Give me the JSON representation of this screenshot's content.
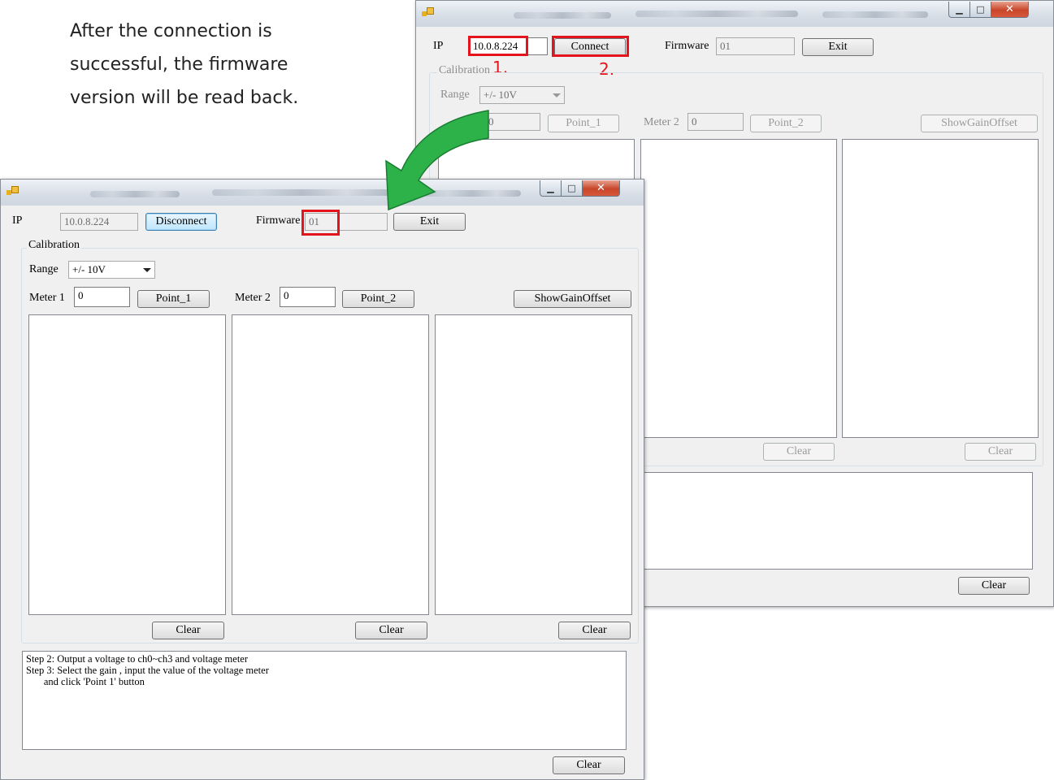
{
  "caption": {
    "line1": "After the connection is",
    "line2": "successful, the firmware",
    "line3": "version will be read back."
  },
  "window_back": {
    "ip_label": "IP",
    "ip_value": "10.0.8.224",
    "connect_label": "Connect",
    "firmware_label": "Firmware",
    "firmware_value": "01",
    "exit_label": "Exit",
    "step1": "1.",
    "step2": "2.",
    "calibration_title": "Calibration",
    "range_label": "Range",
    "range_value": "+/- 10V",
    "meter1_value": "0",
    "point1_label": "Point_1",
    "meter2_label": "Meter 2",
    "meter2_value": "0",
    "point2_label": "Point_2",
    "show_gain_label": "ShowGainOffset",
    "clear_labels": [
      "Clear",
      "Clear",
      "Clear"
    ]
  },
  "window_front": {
    "ip_label": "IP",
    "ip_value": "10.0.8.224",
    "disconnect_label": "Disconnect",
    "firmware_label": "Firmware",
    "firmware_value": "01",
    "exit_label": "Exit",
    "calibration_title": "Calibration",
    "range_label": "Range",
    "range_value": "+/- 10V",
    "meter1_label": "Meter 1",
    "meter1_value": "0",
    "point1_label": "Point_1",
    "meter2_label": "Meter 2",
    "meter2_value": "0",
    "point2_label": "Point_2",
    "show_gain_label": "ShowGainOffset",
    "clear_labels": [
      "Clear",
      "Clear",
      "Clear",
      "Clear"
    ],
    "log_lines": [
      "Step 2: Output a voltage to ch0~ch3 and voltage meter",
      "Step 3: Select the gain , input the value of the voltage meter",
      "       and click 'Point 1' button"
    ]
  },
  "colors": {
    "highlight_red": "#e3141c",
    "arrow_green": "#17a34a",
    "window_bg": "#f0f0f0"
  },
  "icons": [
    "app-icon",
    "minimize-icon",
    "maximize-icon",
    "close-icon",
    "dropdown-arrow-icon",
    "curved-arrow-icon"
  ]
}
